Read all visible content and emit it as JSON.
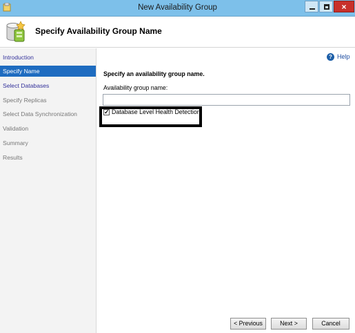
{
  "window": {
    "title": "New Availability Group",
    "close_glyph": "×"
  },
  "header": {
    "title": "Specify Availability Group Name",
    "icon": "database-wizard-icon"
  },
  "sidebar": {
    "items": [
      {
        "label": "Introduction",
        "state": "link"
      },
      {
        "label": "Specify Name",
        "state": "active"
      },
      {
        "label": "Select Databases",
        "state": "link"
      },
      {
        "label": "Specify Replicas",
        "state": "disabled"
      },
      {
        "label": "Select Data Synchronization",
        "state": "disabled"
      },
      {
        "label": "Validation",
        "state": "disabled"
      },
      {
        "label": "Summary",
        "state": "disabled"
      },
      {
        "label": "Results",
        "state": "disabled"
      }
    ]
  },
  "main": {
    "help_icon_glyph": "?",
    "help_label": "Help",
    "instruction": "Specify an availability group name.",
    "name_label": "Availability group name:",
    "name_value": "",
    "health_checkbox": {
      "label": "Database Level Health Detection",
      "checked": true,
      "check_glyph": "✓"
    }
  },
  "footer": {
    "previous_label": "< Previous",
    "next_label": "Next >",
    "cancel_label": "Cancel"
  },
  "colors": {
    "titlebar": "#7dc0ea",
    "active_nav": "#1e6cc0",
    "link_nav": "#33319a",
    "close_button": "#c8302b"
  }
}
